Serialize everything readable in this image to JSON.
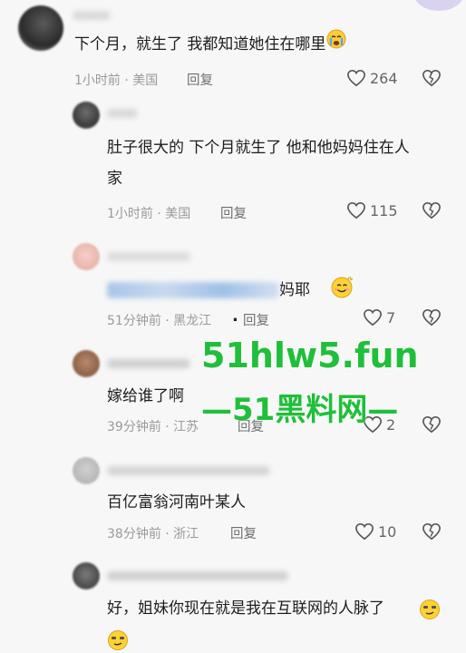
{
  "comments": [
    {
      "text": "下个月，就生了 我都知道她住在哪里",
      "meta": "1小时前 · 美国",
      "reply": "回复",
      "likes": "264"
    },
    {
      "text_line1": "肚子很大的 下个月就生了 他和他妈妈住在人",
      "text_line2": "家",
      "meta": "1小时前 · 美国",
      "reply": "回复",
      "likes": "115"
    },
    {
      "text_suffix": "妈耶",
      "meta": "51分钟前 · 黑龙江",
      "dot": ".",
      "reply": "回复",
      "likes": "7"
    },
    {
      "text": "嫁给谁了啊",
      "meta": "39分钟前 · 江苏",
      "reply": "回复",
      "likes": "2"
    },
    {
      "text": "百亿富翁河南叶某人",
      "meta": "38分钟前 · 浙江",
      "reply": "回复",
      "likes": "10"
    },
    {
      "text": "好，姐妹你现在就是我在互联网的人脉了"
    }
  ],
  "watermark": {
    "line1": "51hlw5.fun",
    "line2": "—51黑料网—"
  },
  "colors": {
    "watermark": "#1fbf3a",
    "background": "#f7f7f7",
    "meta_text": "#9a9a9a"
  },
  "icons": [
    "heart-icon",
    "broken-heart-icon",
    "crying-emoji",
    "smile-emoji",
    "smirk-emoji"
  ]
}
